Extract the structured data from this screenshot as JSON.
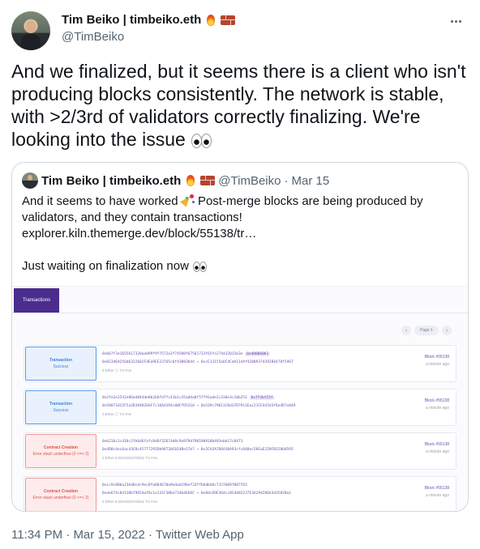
{
  "author": {
    "name": "Tim Beiko | timbeiko.eth",
    "handle": "@TimBeiko",
    "emoji": [
      "fire",
      "brick"
    ]
  },
  "more_icon": "more-horizontal-icon",
  "tweet": {
    "text": "And we finalized, but it seems there is a client who isn't producing blocks consistently. The network is stable, with >2/3rd of validators correctly finalizing. We're looking into the issue",
    "emoji": "eyes"
  },
  "quote": {
    "name": "Tim Beiko | timbeiko.eth",
    "handle": "@TimBeiko",
    "dot": "·",
    "date": "Mar 15",
    "line1": "And it seems to have worked",
    "line1b": "Post-merge blocks are being produced by",
    "line2": "validators, and they contain transactions!",
    "link": "explorer.kiln.themerge.dev/block/55138/tr…",
    "line4": "Just waiting on finalization now"
  },
  "explorer": {
    "tab": "Transactions",
    "page": "Page 1",
    "rows": [
      {
        "kind": "Transaction",
        "status": "Success",
        "state": "ok",
        "hash": "0xbb7f3e1655617320ae099f9f7572a3f74500f67561733f65fe274d12011b3e",
        "badge": "0x40006061",
        "from": "0x023d64256d6322682FdEa9EE23765c6f43B83D44 → 0xcE13155eDCdCdA114Af4280937439286478f5A67",
        "fee": "0 Ether ⓘ TX Fee",
        "block": "Block #55138",
        "ago": "a minute ago"
      },
      {
        "kind": "Transaction",
        "status": "Success",
        "state": "ok",
        "hash": "0x3fe2e1542e86ad844de8b2b6fd7fc41b1c35adda0f57f91ade2c336e3c10b251",
        "badge": "0x7f2bf25f",
        "from": "0x58871015F5a2D394826AF7c16Ad194c80FfD5310 → 0x539c79611C0d37D7911Eac21CE445d3f6e4D7e849",
        "fee": "0 Ether ⓘ TX Fee",
        "block": "Block #55138",
        "ago": "a minute ago"
      },
      {
        "kind": "Contract Creation",
        "status": "Error stack underflow (0 <=> 2)",
        "state": "err",
        "hash": "0xb216c1c418c2fb6d6fafc8d6f32674d8c9a979d790198918b493ebb17c8473",
        "from": "0x4D0c4ec6ac43C8c45777292Db98720C024Be17b7 → 0x2CA2A7D6A10A93cfc040ec58EaE229FB158b0595",
        "fee": "0 Ether 0.0001002370622 TX Fee",
        "block": "Block #55138",
        "ago": "a minute ago"
      },
      {
        "kind": "Contract Creation",
        "status": "Error stack underflow (0 <=> 2)",
        "state": "err",
        "hash": "0xcc9c80ba23b40cdc9ec8fa884670a9edad196ef33ffbbdbd6c7157609f887f63",
        "from": "0xeb674c04110b79654af0c1e131F386e734b4E66C → 0x8dc69E364cc0Cd402237E3A294286A3d35828a1",
        "fee": "0 Ether 0.0001002370622 TX Fee",
        "block": "Block #55138",
        "ago": "a minute ago"
      }
    ]
  },
  "footer": {
    "time": "11:34 PM",
    "dot": "·",
    "date": "Mar 15, 2022",
    "source": "Twitter Web App"
  }
}
